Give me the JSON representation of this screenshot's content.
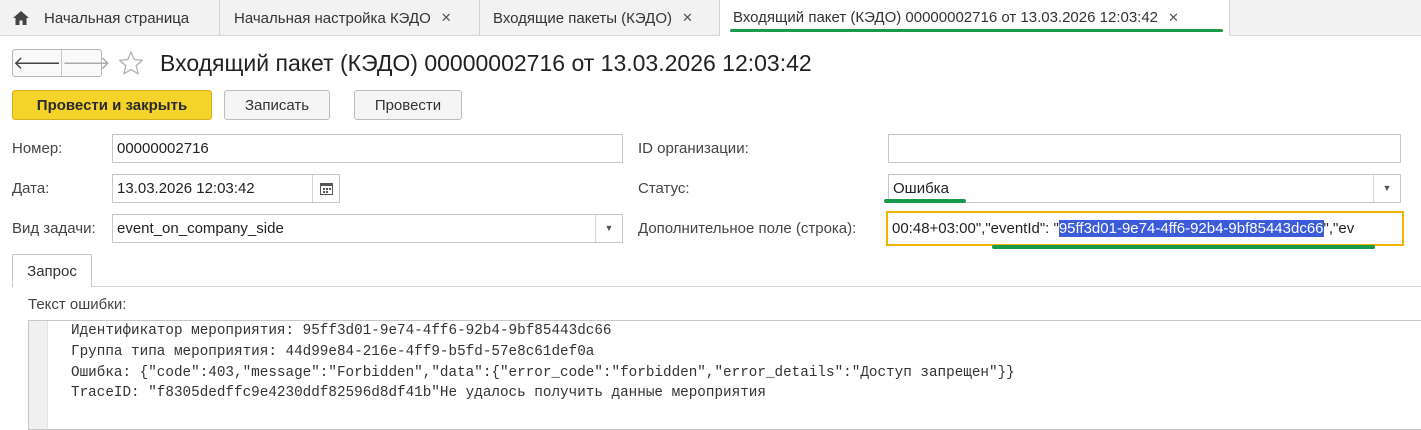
{
  "tabs": [
    {
      "label": "Начальная страница",
      "icon": "home-icon"
    },
    {
      "label": "Начальная настройка КЭДО",
      "closable": true
    },
    {
      "label": "Входящие пакеты (КЭДО)",
      "closable": true
    },
    {
      "label": "Входящий пакет (КЭДО) 00000002716 от 13.03.2026 12:03:42",
      "closable": true,
      "active": true
    }
  ],
  "close_glyph": "✕",
  "nav": {
    "back": "🡐",
    "forward": "🡒"
  },
  "page_title": "Входящий пакет (КЭДО) 00000002716 от 13.03.2026 12:03:42",
  "toolbar": {
    "post_close": "Провести и закрыть",
    "save": "Записать",
    "post": "Провести"
  },
  "form": {
    "number_label": "Номер:",
    "number_value": "00000002716",
    "date_label": "Дата:",
    "date_value": "13.03.2026 12:03:42",
    "task_label": "Вид задачи:",
    "task_value": "event_on_company_side",
    "org_label": "ID организации:",
    "org_value": "",
    "status_label": "Статус:",
    "status_value": "Ошибка",
    "extra_label": "Дополнительное поле (строка):",
    "extra_prefix": "00:48+03:00\",\"eventId\": \"",
    "extra_selected": "95ff3d01-9e74-4ff6-92b4-9bf85443dc66",
    "extra_suffix": "\",\"ev"
  },
  "request_tab": "Запрос",
  "error_label": "Текст ошибки:",
  "error_lines": [
    "Идентификатор мероприятия: 95ff3d01-9e74-4ff6-92b4-9bf85443dc66",
    "Группа типа мероприятия: 44d99e84-216e-4ff9-b5fd-57e8c61def0a",
    "Ошибка: {\"code\":403,\"message\":\"Forbidden\",\"data\":{\"error_code\":\"forbidden\",\"error_details\":\"Доступ запрещен\"}}",
    "TraceID: \"f8305dedffc9e4230ddf82596d8df41b\"Не удалось получить данные мероприятия"
  ],
  "colors": {
    "accent_green": "#1a9a4b",
    "primary_button": "#f4d42a",
    "focus_border": "#f0b400",
    "selection": "#3b5bdb"
  }
}
